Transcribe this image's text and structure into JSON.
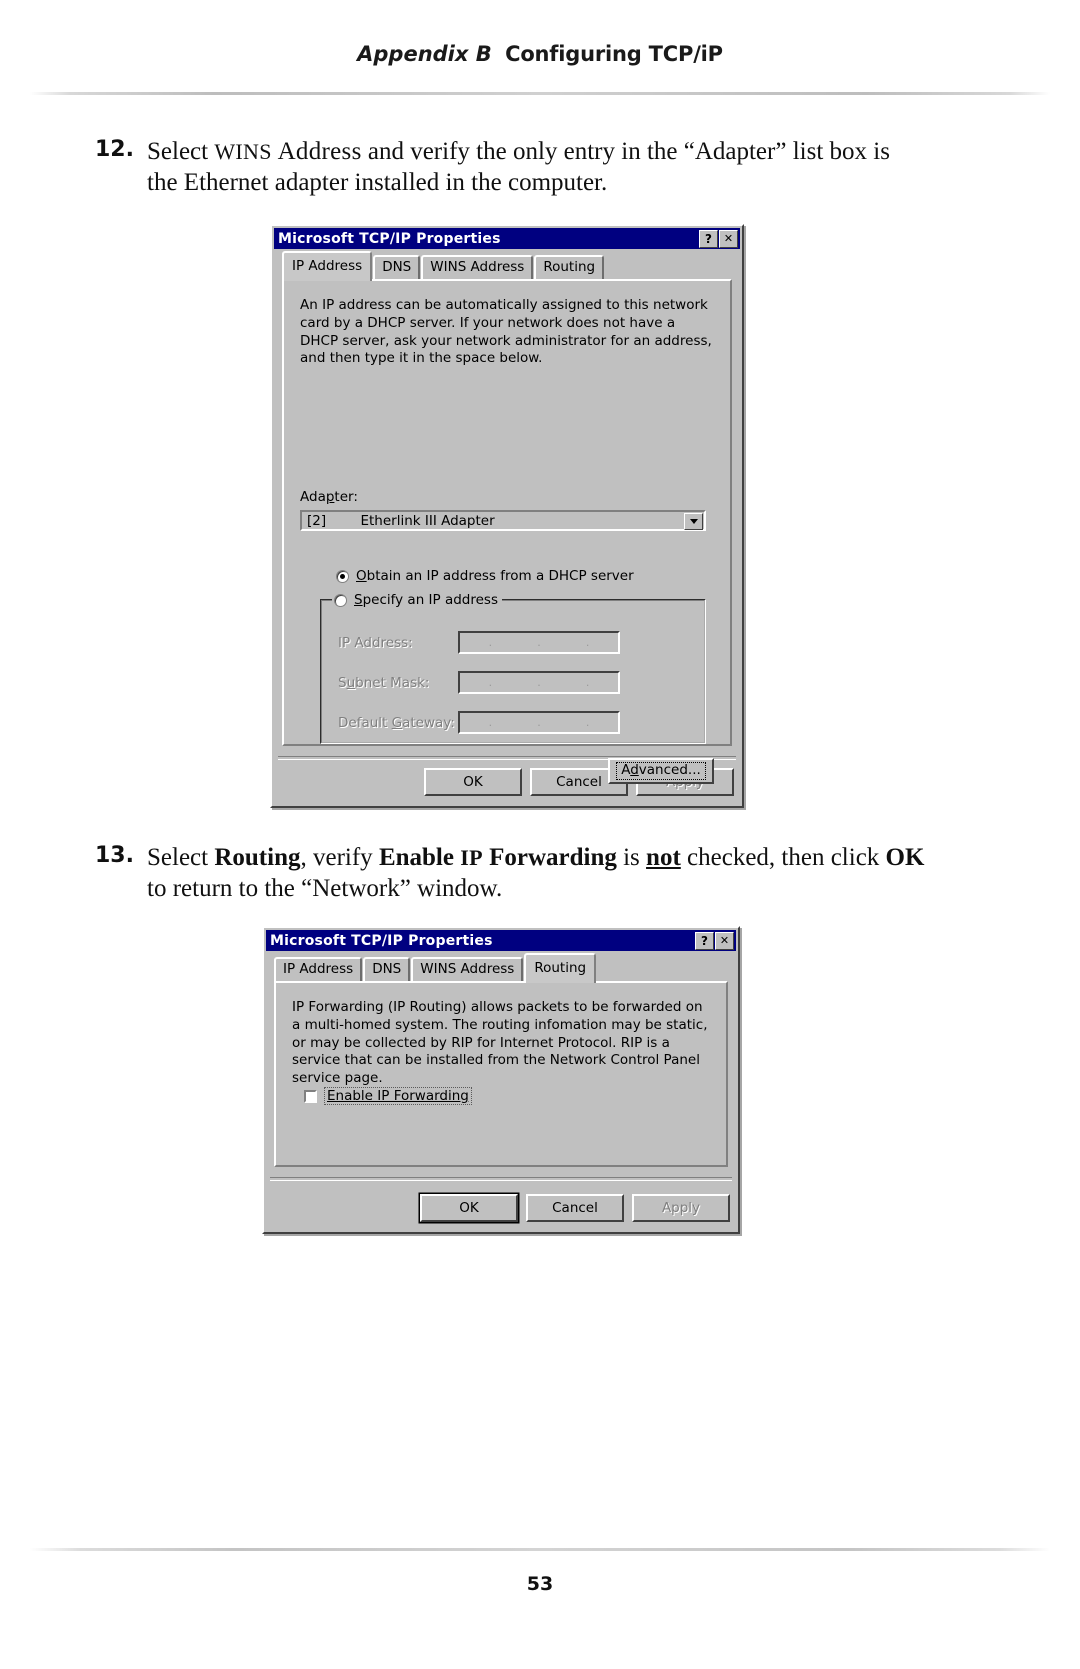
{
  "header": {
    "appendix": "Appendix B",
    "chapter_title": "Configuring TCP/iP"
  },
  "footer": {
    "page_number": "53"
  },
  "steps": [
    {
      "number": "12.",
      "text_parts": [
        {
          "t": "Select ",
          "style": "normal"
        },
        {
          "t": "WINS Address",
          "style": "bold"
        },
        {
          "t": " and verify the only entry in the “Adapter” list box is the Ethernet adapter installed in the computer.",
          "style": "normal"
        }
      ]
    },
    {
      "number": "13.",
      "text_parts": [
        {
          "t": "Select ",
          "style": "normal"
        },
        {
          "t": "Routing",
          "style": "bold"
        },
        {
          "t": ", verify ",
          "style": "normal"
        },
        {
          "t": "Enable IP Forwarding",
          "style": "bold"
        },
        {
          "t": " is ",
          "style": "normal"
        },
        {
          "t": "not",
          "style": "bold-underline"
        },
        {
          "t": " checked, then click ",
          "style": "normal"
        },
        {
          "t": "OK",
          "style": "bold"
        },
        {
          "t": " to return to the “Network” window.",
          "style": "normal"
        }
      ]
    }
  ],
  "dialog_ip": {
    "title": "Microsoft TCP/IP Properties",
    "titlebar_buttons": [
      {
        "name": "help-button",
        "glyph": "?"
      },
      {
        "name": "close-button",
        "glyph": "✕"
      }
    ],
    "tabs": [
      {
        "label": "IP Address",
        "active": true
      },
      {
        "label": "DNS",
        "active": false
      },
      {
        "label": "WINS Address",
        "active": false
      },
      {
        "label": "Routing",
        "active": false
      }
    ],
    "description": "An IP address can be automatically assigned to this network card by a DHCP server.  If your network does not have a DHCP server, ask your network administrator for an address, and then type it in the space below.",
    "adapter_label": "Adapter:",
    "adapter_value": "[2]        Etherlink III Adapter",
    "radio_dhcp": {
      "label": "Obtain an IP address from a DHCP server",
      "selected": true
    },
    "radio_specify": {
      "label": "Specify an IP address",
      "selected": false
    },
    "fields": [
      {
        "label": "IP Address:",
        "value": "",
        "enabled": false
      },
      {
        "label": "Subnet Mask:",
        "value": "",
        "enabled": false
      },
      {
        "label": "Default Gateway:",
        "value": "",
        "enabled": false
      }
    ],
    "advanced_button": "Advanced...",
    "buttons": [
      {
        "label": "OK",
        "enabled": true,
        "default": false
      },
      {
        "label": "Cancel",
        "enabled": true,
        "default": false
      },
      {
        "label": "Apply",
        "enabled": false,
        "default": false
      }
    ]
  },
  "dialog_routing": {
    "title": "Microsoft TCP/IP Properties",
    "titlebar_buttons": [
      {
        "name": "help-button",
        "glyph": "?"
      },
      {
        "name": "close-button",
        "glyph": "✕"
      }
    ],
    "tabs": [
      {
        "label": "IP Address",
        "active": false
      },
      {
        "label": "DNS",
        "active": false
      },
      {
        "label": "WINS Address",
        "active": false
      },
      {
        "label": "Routing",
        "active": true
      }
    ],
    "description": "IP Forwarding (IP Routing) allows packets to be forwarded on a multi-homed system.  The routing infomation may be static, or may be collected by RIP for Internet Protocol. RIP is a service that can be installed from the Network Control Panel service page.",
    "checkbox": {
      "label": "Enable IP Forwarding",
      "checked": false
    },
    "buttons": [
      {
        "label": "OK",
        "enabled": true,
        "default": true
      },
      {
        "label": "Cancel",
        "enabled": true,
        "default": false
      },
      {
        "label": "Apply",
        "enabled": false,
        "default": false
      }
    ]
  },
  "colors": {
    "titlebar": "#000080",
    "dialog_face": "#c0c0c0",
    "disabled_text": "#808080"
  }
}
